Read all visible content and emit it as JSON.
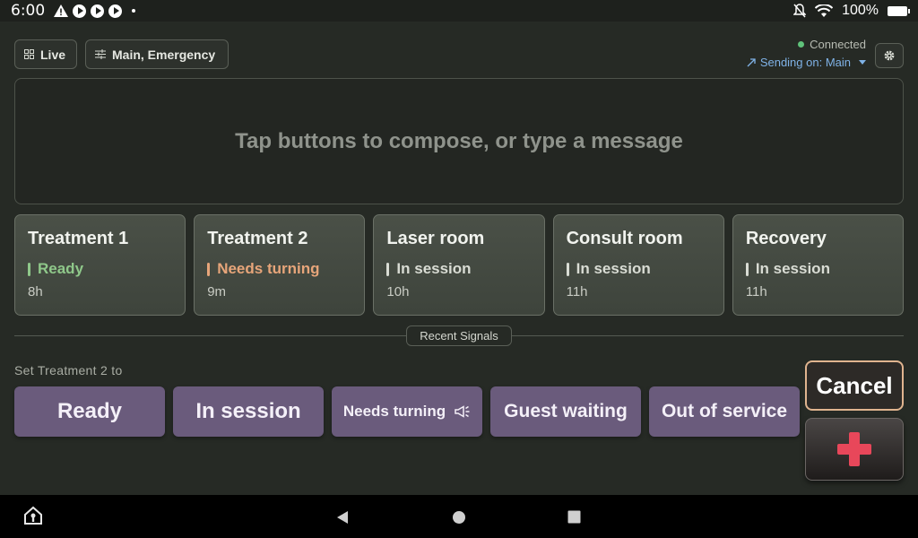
{
  "status_bar": {
    "time": "6:00",
    "battery": "100%"
  },
  "toolbar": {
    "live_label": "Live",
    "channels_label": "Main, Emergency"
  },
  "connection": {
    "status": "Connected",
    "sending": "Sending on: Main",
    "status_color": "#5fc27a"
  },
  "compose": {
    "placeholder": "Tap buttons to compose, or type a message"
  },
  "rooms": [
    {
      "name": "Treatment 1",
      "status": "Ready",
      "age": "8h",
      "status_color": "#8fc88a"
    },
    {
      "name": "Treatment 2",
      "status": "Needs turning",
      "age": "9m",
      "status_color": "#e7a57a"
    },
    {
      "name": "Laser room",
      "status": "In session",
      "age": "10h",
      "status_color": "#d9dcd4"
    },
    {
      "name": "Consult room",
      "status": "In session",
      "age": "11h",
      "status_color": "#d9dcd4"
    },
    {
      "name": "Recovery",
      "status": "In session",
      "age": "11h",
      "status_color": "#d9dcd4"
    }
  ],
  "recent_signals": "Recent Signals",
  "set_prompt": "Set Treatment 2 to",
  "actions": {
    "ready": "Ready",
    "in_session": "In session",
    "needs_turning": "Needs turning",
    "guest_waiting": "Guest waiting",
    "out_of_service": "Out of service"
  },
  "cancel_label": "Cancel",
  "colors": {
    "action_purple": "#6a5b7c",
    "emergency_red": "#e8475a",
    "cancel_border": "#e0b48f"
  }
}
